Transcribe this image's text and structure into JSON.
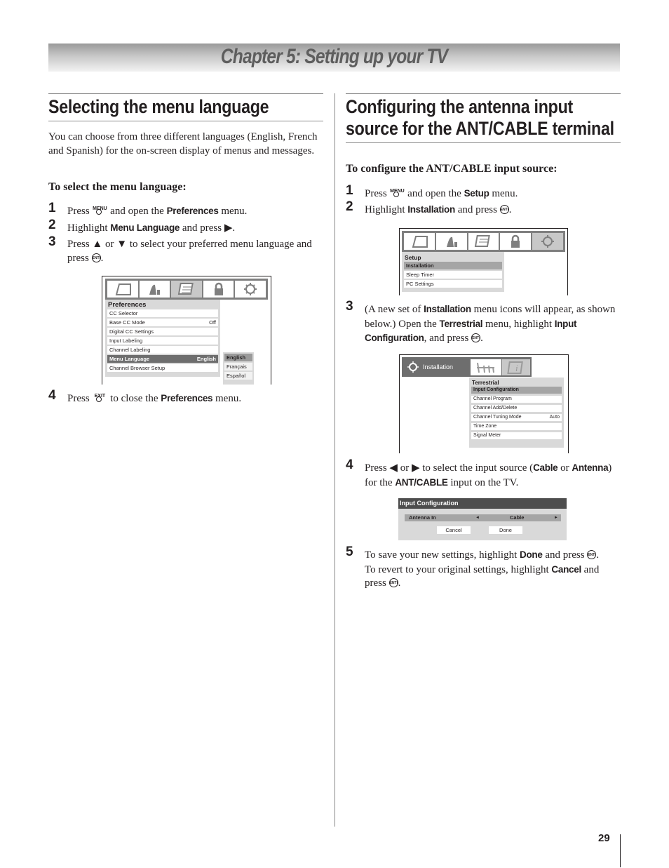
{
  "chapter": {
    "title": "Chapter 5: Setting up your TV"
  },
  "left": {
    "title": "Selecting the menu language",
    "intro": "You can choose from three different languages (English, French and Spanish) for the on-screen display of menus and messages.",
    "subhead": "To select the menu language:",
    "steps": [
      {
        "num": "1",
        "pre": "Press",
        "button": "MENU",
        "mid": "and open the",
        "bold": "Preferences",
        "post": "menu."
      },
      {
        "num": "2",
        "pre": "Highlight",
        "bold": "Menu Language",
        "post": "and press ▶."
      },
      {
        "num": "3",
        "pre": "Press ▲ or ▼ to select your preferred menu language and press",
        "post": "."
      },
      {
        "num": "4",
        "pre": "Press",
        "button": "EXIT",
        "mid": "to close the",
        "bold": "Preferences",
        "post": "menu."
      }
    ],
    "screen": {
      "icons": [
        "picture-icon",
        "sound-icon",
        "preferences-icon",
        "lock-icon",
        "setup-icon"
      ],
      "selected_icon": 2,
      "menu_title": "Preferences",
      "items": [
        {
          "label": "CC Selector",
          "value": ""
        },
        {
          "label": "Base CC Mode",
          "value": "Off"
        },
        {
          "label": "Digital CC Settings",
          "value": ""
        },
        {
          "label": "Input Labeling",
          "value": ""
        },
        {
          "label": "Channel Labeling",
          "value": ""
        },
        {
          "label": "Menu Language",
          "value": "English",
          "highlighted": true
        },
        {
          "label": "Channel Browser Setup",
          "value": ""
        }
      ],
      "languages": [
        "English",
        "Français",
        "Español"
      ],
      "selected_language": "English"
    }
  },
  "right": {
    "title_line1": "Configuring the antenna input",
    "title_line2": "source for the ANT/CABLE terminal",
    "subhead": "To configure the ANT/CABLE input source:",
    "steps": [
      {
        "num": "1",
        "pre": "Press",
        "button": "MENU",
        "mid": "and open the",
        "bold": "Setup",
        "post": "menu."
      },
      {
        "num": "2",
        "pre": "Highlight",
        "bold": "Installation",
        "post": "and press"
      },
      {
        "num": "3",
        "t1": "(A new set of",
        "b1": "Installation",
        "t2": "menu icons will appear, as shown below.) Open the",
        "b2": "Terrestrial",
        "t3": "menu, highlight",
        "b3": "Input Configuration",
        "t4": ", and press"
      },
      {
        "num": "4",
        "t1": "Press ◀ or ▶ to select the input source (",
        "b1": "Cable",
        "t2": "or",
        "b2": "Antenna",
        "t3": ") for the",
        "b3": "ANT/CABLE",
        "t4": "input on the TV."
      },
      {
        "num": "5",
        "t1": "To save your new settings, highlight",
        "b1": "Done",
        "t2": "and press",
        "t3": "To revert to your original settings, highlight",
        "b2": "Cancel",
        "t4": "and press"
      }
    ],
    "screen1": {
      "menu_title": "Setup",
      "items": [
        {
          "label": "Installation",
          "highlighted": true
        },
        {
          "label": "Sleep Timer"
        },
        {
          "label": "PC Settings"
        }
      ],
      "selected_icon": 4
    },
    "screen2": {
      "tab_label": "Installation",
      "tab_icons": [
        "terrestrial-antenna-icon",
        "info-icon"
      ],
      "menu_title": "Terrestrial",
      "items": [
        {
          "label": "Input Configuration",
          "value": "",
          "highlighted": true
        },
        {
          "label": "Channel Program",
          "value": ""
        },
        {
          "label": "Channel Add/Delete",
          "value": ""
        },
        {
          "label": "Channel Tuning Mode",
          "value": "Auto"
        },
        {
          "label": "Time Zone",
          "value": ""
        },
        {
          "label": "Signal Meter",
          "value": ""
        }
      ]
    },
    "dialog": {
      "title": "Input Configuration",
      "row_label": "Antenna In",
      "row_value": "Cable",
      "left_arrow": "◄",
      "right_arrow": "►",
      "cancel": "Cancel",
      "done": "Done"
    }
  },
  "enter_label": "ENTER",
  "page_number": "29"
}
